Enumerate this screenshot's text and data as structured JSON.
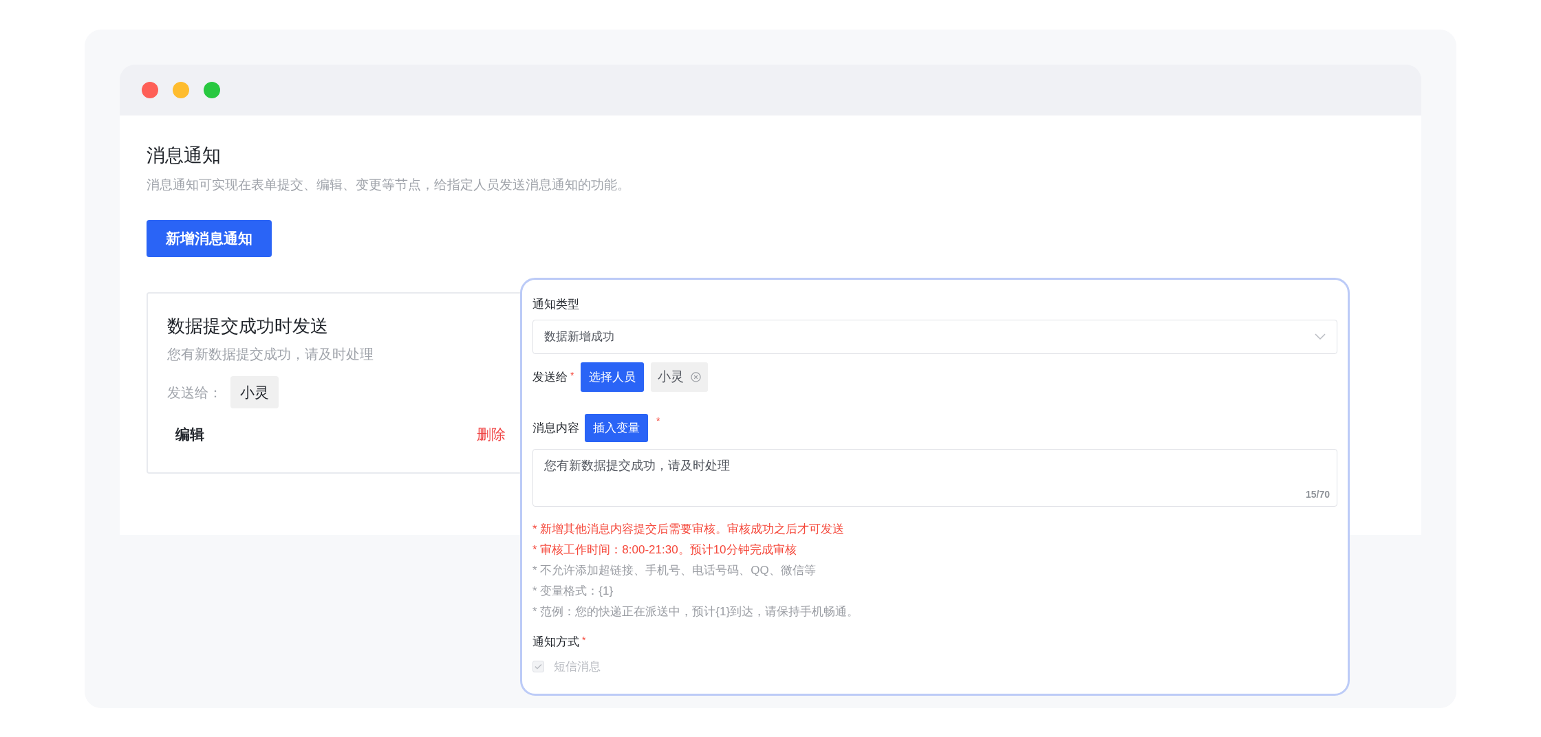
{
  "window": {
    "controls": [
      {
        "color": "#fe5f57"
      },
      {
        "color": "#febc2e"
      },
      {
        "color": "#28c840"
      }
    ]
  },
  "page": {
    "title": "消息通知",
    "description": "消息通知可实现在表单提交、编辑、变更等节点，给指定人员发送消息通知的功能。",
    "add_button": "新增消息通知"
  },
  "notification_card": {
    "title": "数据提交成功时发送",
    "message": "您有新数据提交成功，请及时处理",
    "send_to_label": "发送给：",
    "recipients": [
      "小灵"
    ],
    "edit": "编辑",
    "delete": "删除"
  },
  "editor": {
    "required_mark": "*",
    "type_label": "通知类型",
    "type_value": "数据新增成功",
    "send_to_label": "发送给",
    "send_to_required": true,
    "select_button": "选择人员",
    "recipients": [
      "小灵"
    ],
    "content_label": "消息内容",
    "insert_button": "插入变量",
    "content_required": true,
    "content_value": "您有新数据提交成功，请及时处理",
    "char_count": "15/70",
    "notes": [
      {
        "text": "* 新增其他消息内容提交后需要审核。审核成功之后才可发送",
        "kind": "warning"
      },
      {
        "text": "* 审核工作时间：8:00-21:30。预计10分钟完成审核",
        "kind": "warning"
      },
      {
        "text": "* 不允许添加超链接、手机号、电话号码、QQ、微信等",
        "kind": "info"
      },
      {
        "text": "* 变量格式：{1}",
        "kind": "info"
      },
      {
        "text": "* 范例：您的快递正在派送中，预计{1}到达，请保持手机畅通。",
        "kind": "info"
      }
    ],
    "method_label": "通知方式",
    "method_required": true,
    "methods": [
      {
        "label": "短信消息",
        "checked": true,
        "disabled": true
      }
    ]
  }
}
